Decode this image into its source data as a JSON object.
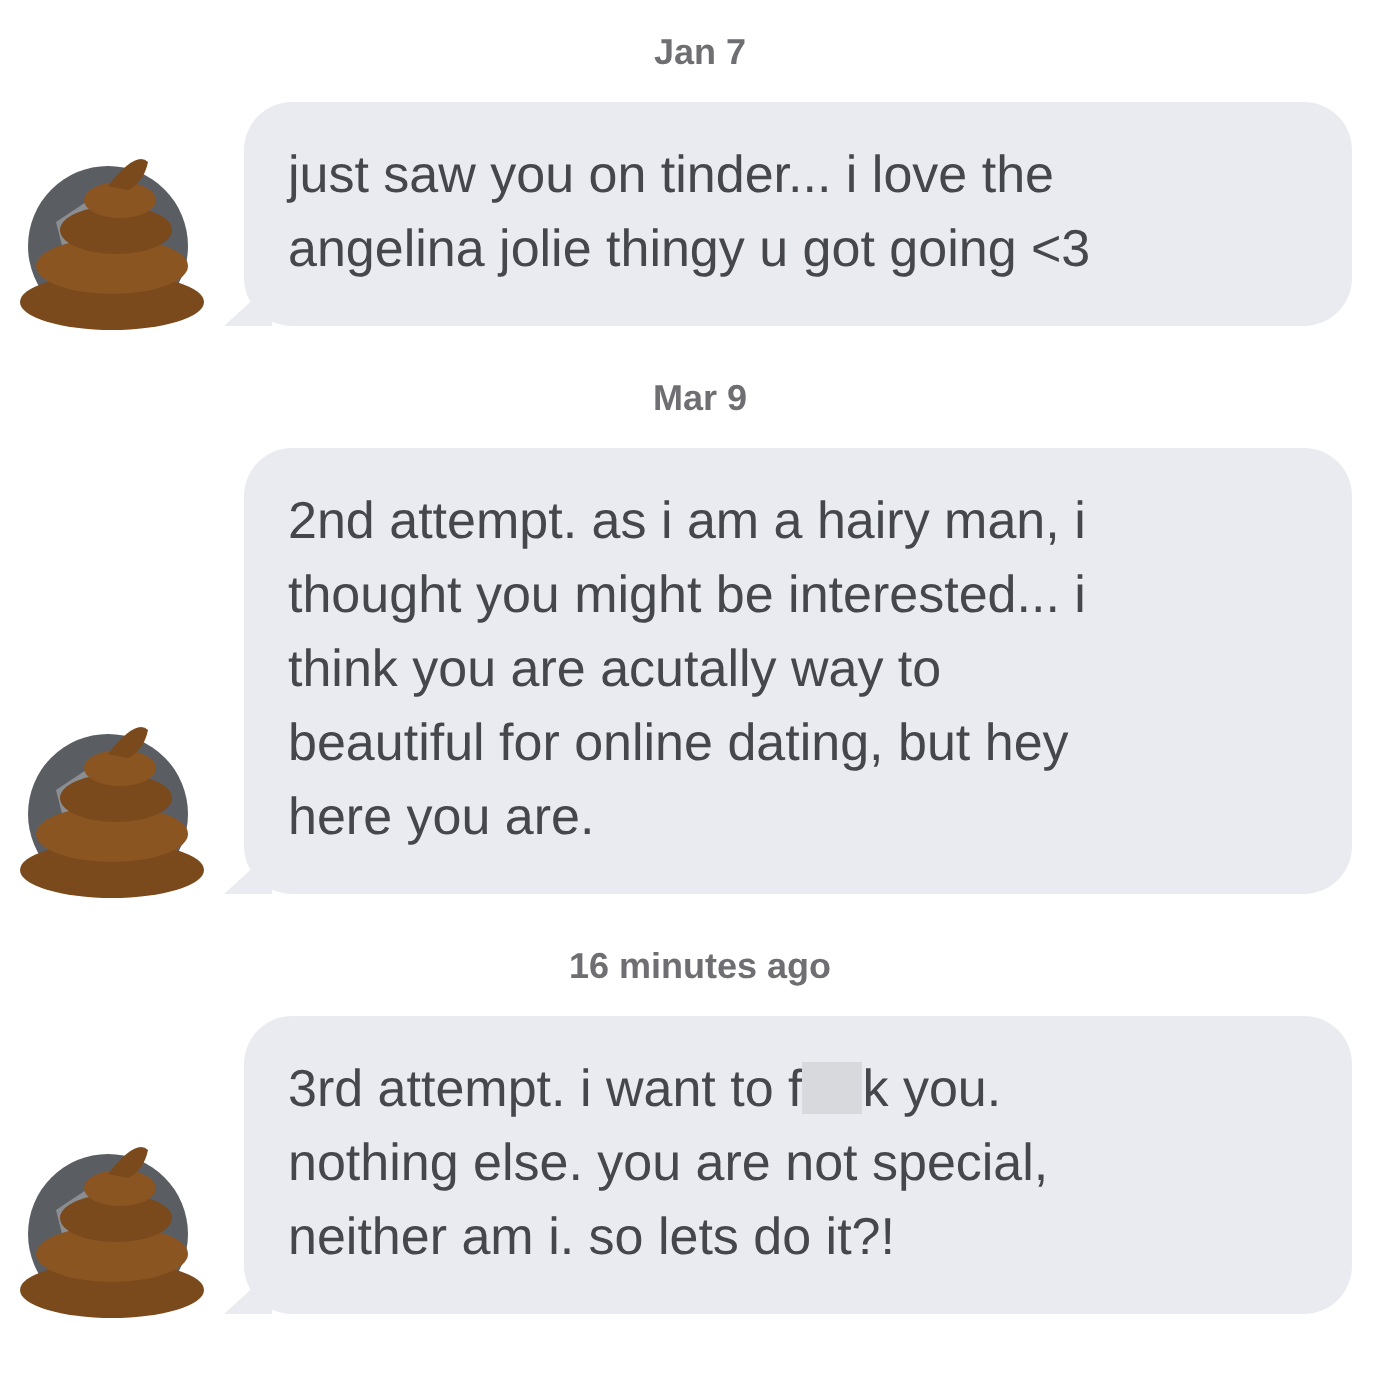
{
  "thread": [
    {
      "timestamp": "Jan 7",
      "parts": [
        {
          "kind": "text",
          "text": "just saw you on tinder... i love the\nangelina jolie thingy u got going <3"
        }
      ]
    },
    {
      "timestamp": "Mar 9",
      "parts": [
        {
          "kind": "text",
          "text": "2nd attempt. as i am a hairy man, i\nthought you might be interested... i\nthink you are acutally way to\nbeautiful for online dating, but hey\nhere you are."
        }
      ]
    },
    {
      "timestamp": "16 minutes ago",
      "parts": [
        {
          "kind": "text",
          "text": "3rd attempt. i want to f"
        },
        {
          "kind": "redacted"
        },
        {
          "kind": "text",
          "text": "k you.\nnothing else. you are not special,\nneither am i. so lets do it?!"
        }
      ]
    }
  ]
}
